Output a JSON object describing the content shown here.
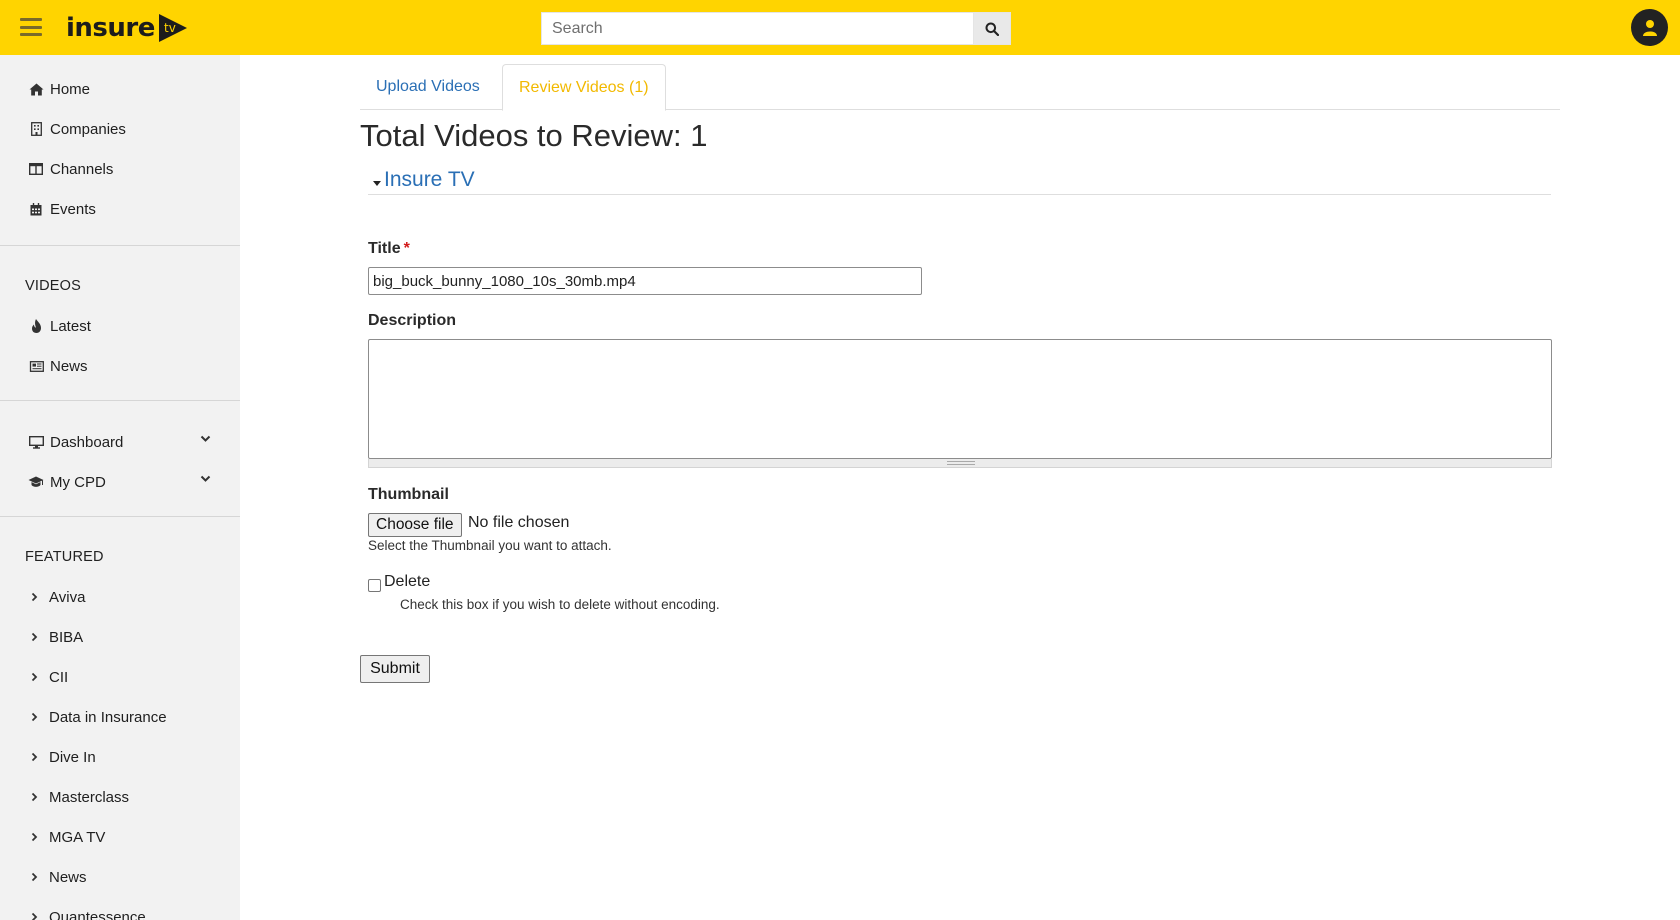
{
  "header": {
    "logo_text": "insure",
    "logo_badge": "tv",
    "search_placeholder": "Search",
    "brand_color": "#ffd400"
  },
  "sidebar": {
    "main_items": [
      {
        "label": "Home",
        "icon": "home-icon"
      },
      {
        "label": "Companies",
        "icon": "building-icon"
      },
      {
        "label": "Channels",
        "icon": "columns-icon"
      },
      {
        "label": "Events",
        "icon": "calendar-icon"
      }
    ],
    "videos_heading": "VIDEOS",
    "video_items": [
      {
        "label": "Latest",
        "icon": "fire-icon"
      },
      {
        "label": "News",
        "icon": "newspaper-icon"
      }
    ],
    "account_items": [
      {
        "label": "Dashboard",
        "icon": "desktop-icon"
      },
      {
        "label": "My CPD",
        "icon": "graduation-cap-icon"
      }
    ],
    "featured_heading": "FEATURED",
    "featured_items": [
      "Aviva",
      "BIBA",
      "CII",
      "Data in Insurance",
      "Dive In",
      "Masterclass",
      "MGA TV",
      "News",
      "Quantessence"
    ]
  },
  "main": {
    "tabs": [
      {
        "label": "Upload Videos",
        "active": false
      },
      {
        "label": "Review Videos (1)",
        "active": true
      }
    ],
    "page_title": "Total Videos to Review: 1",
    "group_title": "Insure TV",
    "form": {
      "title_label": "Title",
      "required_marker": "*",
      "title_value": "big_buck_bunny_1080_10s_30mb.mp4",
      "description_label": "Description",
      "description_value": "",
      "thumbnail_label": "Thumbnail",
      "choose_file_label": "Choose file",
      "file_status": "No file chosen",
      "thumbnail_help": "Select the Thumbnail you want to attach.",
      "delete_label": "Delete",
      "delete_checked": false,
      "delete_help": "Check this box if you wish to delete without encoding.",
      "submit_label": "Submit"
    }
  },
  "colors": {
    "link": "#2a6fb5",
    "active_tab": "#f2b900",
    "required": "#d21a1a",
    "sidebar_bg": "#f2f2f2"
  }
}
